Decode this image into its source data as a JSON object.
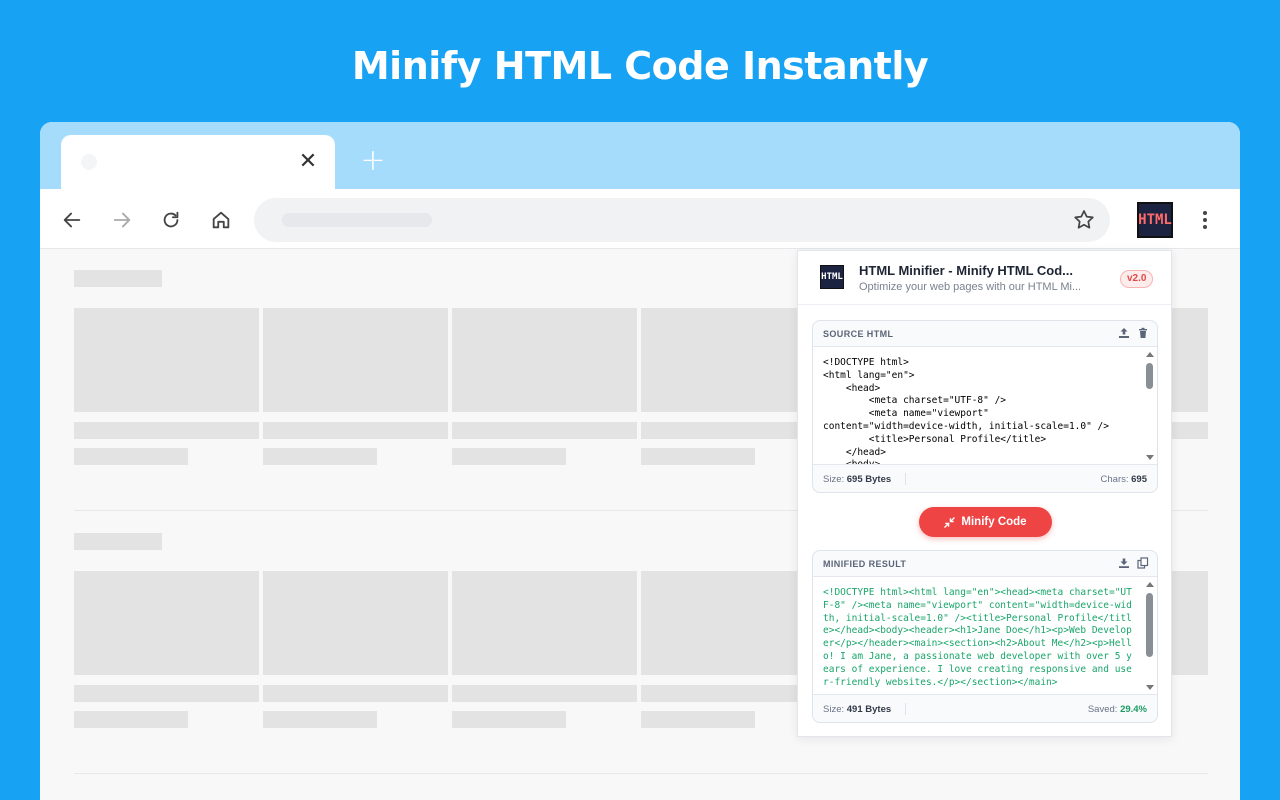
{
  "headline": "Minify HTML Code Instantly",
  "browser": {
    "tab_close": "✕",
    "new_tab": "+"
  },
  "extension_icon_text": "HTML",
  "popup": {
    "title": "HTML Minifier - Minify HTML Cod...",
    "subtitle": "Optimize your web pages with our HTML Mi...",
    "version": "v2.0",
    "source": {
      "label": "SOURCE HTML",
      "lines": [
        "<!DOCTYPE html>",
        "<html lang=\"en\">",
        "    <head>",
        "        <meta charset=\"UTF-8\" />",
        "        <meta name=\"viewport\"",
        "content=\"width=device-width, initial-scale=1.0\" />",
        "        <title>Personal Profile</title>",
        "    </head>",
        "    <body>"
      ],
      "size_label": "Size:",
      "size_value": "695 Bytes",
      "chars_label": "Chars:",
      "chars_value": "695"
    },
    "minify_button": "Minify Code",
    "result": {
      "label": "MINIFIED RESULT",
      "code": "<!DOCTYPE html><html lang=\"en\"><head><meta charset=\"UTF-8\" /><meta name=\"viewport\" content=\"width=device-width, initial-scale=1.0\" /><title>Personal Profile</title></head><body><header><h1>Jane Doe</h1><p>Web Developer</p></header><main><section><h2>About Me</h2><p>Hello! I am Jane, a passionate web developer with over 5 years of experience. I love creating responsive and user-friendly websites.</p></section></main>",
      "size_label": "Size:",
      "size_value": "491 Bytes",
      "saved_label": "Saved:",
      "saved_value": "29.4%"
    }
  }
}
